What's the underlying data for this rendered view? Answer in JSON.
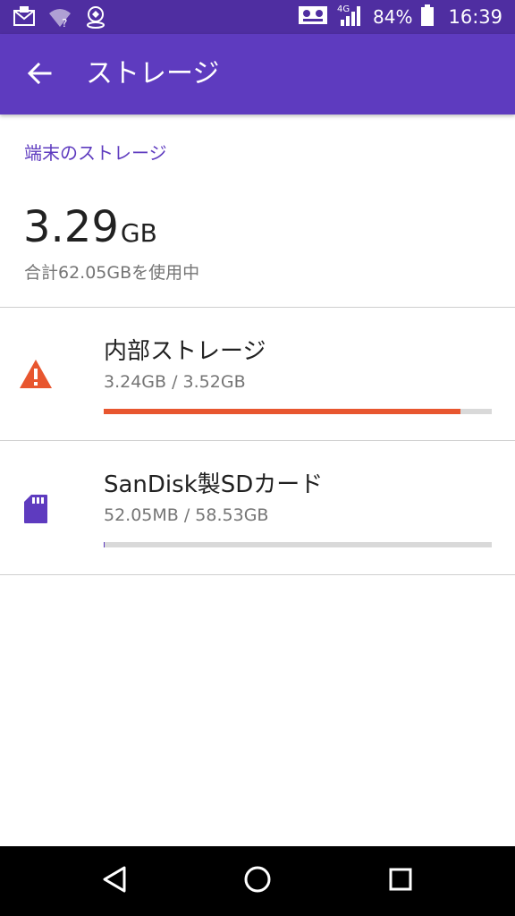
{
  "status_bar": {
    "network": "4G",
    "battery": "84%",
    "time": "16:39",
    "icons": [
      "mail-notification-icon",
      "wifi-unknown-icon",
      "location-notification-icon",
      "voicemail-icon",
      "signal-icon",
      "battery-icon"
    ]
  },
  "app_bar": {
    "title": "ストレージ",
    "back_icon": "arrow-back-icon"
  },
  "device_storage": {
    "header": "端末のストレージ",
    "used_value": "3.29",
    "used_unit": "GB",
    "total_caption": "合計62.05GBを使用中"
  },
  "items": [
    {
      "title": "内部ストレージ",
      "summary": "3.24GB / 3.52GB",
      "usage_fraction": 0.92,
      "icon": "warning-icon",
      "color": "#e8562f"
    },
    {
      "title": "SanDisk製SDカード",
      "summary": "52.05MB / 58.53GB",
      "usage_fraction": 0.001,
      "icon": "sd-card-icon",
      "color": "#5e3bbf"
    }
  ],
  "nav_bar": {
    "icons": [
      "back-triangle-icon",
      "home-circle-icon",
      "recents-square-icon"
    ]
  },
  "colors": {
    "status_bar": "#4f2ea1",
    "app_bar": "#5e3bbf",
    "accent": "#5e3bbf",
    "warning": "#e8562f",
    "track": "#d9d9d9"
  }
}
